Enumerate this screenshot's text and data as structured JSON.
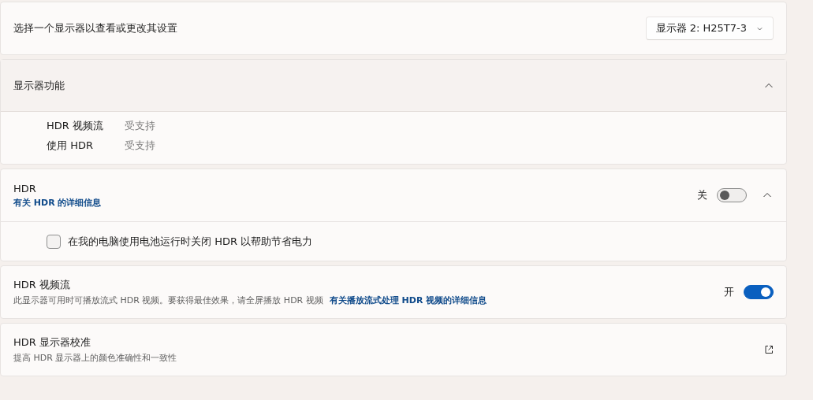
{
  "display_select": {
    "label": "选择一个显示器以查看或更改其设置",
    "dropdown": {
      "value": "显示器 2: H25T7-3"
    }
  },
  "display_features": {
    "title": "显示器功能",
    "expanded": true,
    "rows": [
      {
        "name": "HDR 视频流",
        "value": "受支持"
      },
      {
        "name": "使用 HDR",
        "value": "受支持"
      }
    ]
  },
  "hdr": {
    "title": "HDR",
    "link": "有关 HDR 的详细信息",
    "toggle": {
      "label": "关",
      "on": false
    },
    "expanded": true,
    "battery_option": {
      "label": "在我的电脑使用电池运行时关闭 HDR 以帮助节省电力",
      "checked": false
    }
  },
  "hdr_video": {
    "title": "HDR 视频流",
    "description": "此显示器可用时可播放流式 HDR 视频。要获得最佳效果，请全屏播放 HDR 视频",
    "link": "有关播放流式处理 HDR 视频的详细信息",
    "toggle": {
      "label": "开",
      "on": true
    }
  },
  "calibration": {
    "title": "HDR 显示器校准",
    "description": "提高 HDR 显示器上的颜色准确性和一致性"
  }
}
